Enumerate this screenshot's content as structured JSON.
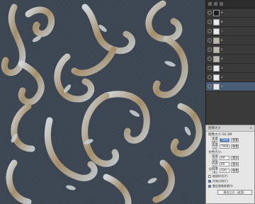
{
  "layers": [
    {
      "name": "9",
      "thumb": "dark"
    },
    {
      "name": "8",
      "thumb": "light"
    },
    {
      "name": "7",
      "thumb": "light"
    },
    {
      "name": "6",
      "thumb": "pattern"
    },
    {
      "name": "5",
      "thumb": "pattern"
    },
    {
      "name": "4",
      "thumb": "pattern"
    },
    {
      "name": "3",
      "thumb": "light"
    },
    {
      "name": "2",
      "thumb": "light"
    },
    {
      "name": "1",
      "thumb": "light"
    }
  ],
  "dialog": {
    "title": "图像大小",
    "close_label": "×",
    "image_size_label": "图像大小:56.3M",
    "pixel_dims": {
      "width_label": "宽度(W):",
      "width_value": "7000",
      "width_unit": "像素",
      "height_label": "高度(H):",
      "height_value": "7000",
      "height_unit": "像素"
    },
    "doc_size_label": "文档大小:",
    "doc_size": {
      "width_label": "宽度(D):",
      "width_value": "69",
      "width_unit": "厘米",
      "height_label": "高度(G):",
      "height_value": "69",
      "height_unit": "厘米",
      "res_label": "分辨率(R):",
      "res_value": "120",
      "res_unit": "像素"
    },
    "checks": [
      {
        "label": "缩放样式(Y)",
        "checked": false
      },
      {
        "label": "约束比例(C)",
        "checked": true
      },
      {
        "label": "重定图像像素(I):",
        "checked": true
      }
    ],
    "resample_value": "两次立方（适用）"
  },
  "colors": {
    "fabric": "#3d4753",
    "scroll_silver": "#c8ccd0",
    "scroll_gold": "#a88a55",
    "panel": "#3a3a3a",
    "dialog": "#e6e6e6",
    "accent": "#3b74c9"
  }
}
